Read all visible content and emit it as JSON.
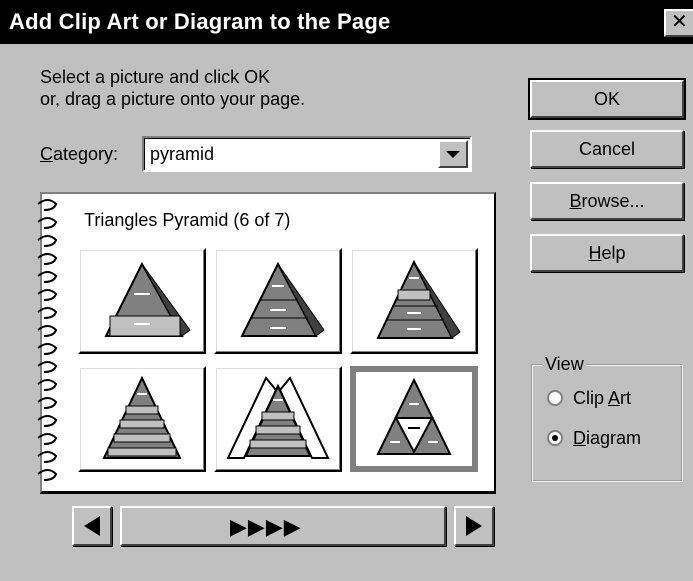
{
  "window": {
    "title": "Add Clip Art or Diagram to the Page",
    "close_label": "✕"
  },
  "instructions": {
    "line1": "Select a picture and click OK",
    "line2": "or, drag a picture onto your page."
  },
  "category": {
    "label_accel": "C",
    "label_rest": "ategory:",
    "value": "pyramid"
  },
  "buttons": {
    "ok": "OK",
    "cancel": "Cancel",
    "browse_accel": "B",
    "browse_rest": "rowse...",
    "help_accel": "H",
    "help_rest": "elp"
  },
  "gallery": {
    "title": "Triangles Pyramid (6 of 7)",
    "selected_index": 5,
    "thumbnails": [
      {
        "name": "pyramid-3-level-hatched"
      },
      {
        "name": "pyramid-3-level-solid"
      },
      {
        "name": "pyramid-5-level"
      },
      {
        "name": "pyramid-6-level"
      },
      {
        "name": "pyramid-framed"
      },
      {
        "name": "pyramid-triangle-split"
      }
    ]
  },
  "navigation": {
    "prev_icon": "left-arrow-icon",
    "progress_arrows": "▶▶▶▶",
    "next_icon": "right-arrow-icon"
  },
  "view": {
    "legend": "View",
    "clip_art_pre": "Clip ",
    "clip_art_accel": "A",
    "clip_art_post": "rt",
    "diagram_accel": "D",
    "diagram_rest": "iagram",
    "selected": "Diagram"
  },
  "colors": {
    "face": "#c0c0c0",
    "titlebar": "#000000",
    "pyramid": "#808080"
  }
}
